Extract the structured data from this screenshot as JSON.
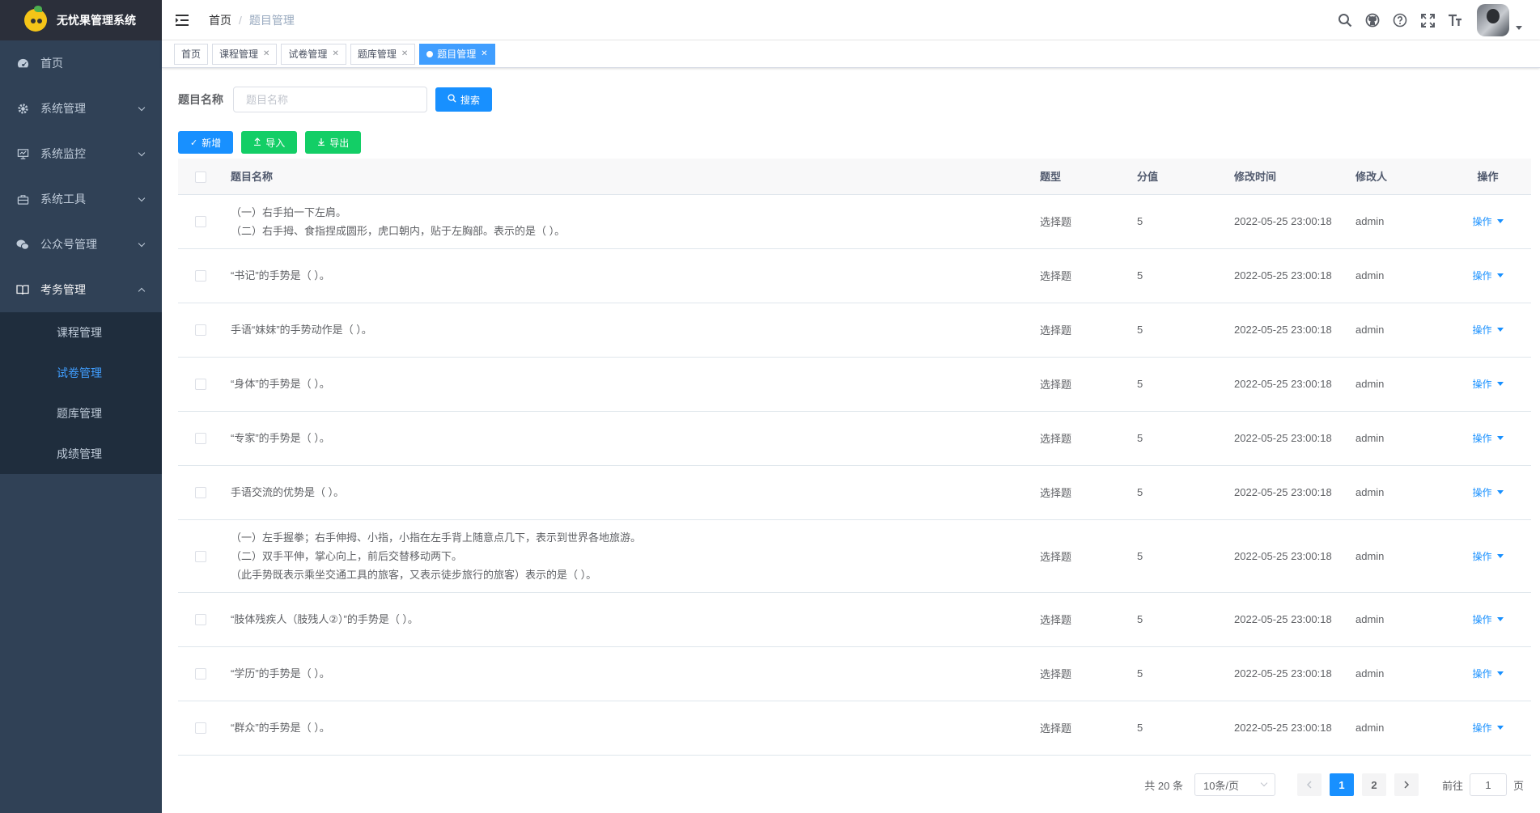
{
  "app": {
    "title": "无忧果管理系统"
  },
  "sidebar": {
    "items": [
      {
        "label": "首页",
        "icon": "dashboard-icon"
      },
      {
        "label": "系统管理",
        "icon": "gear-icon"
      },
      {
        "label": "系统监控",
        "icon": "monitor-icon"
      },
      {
        "label": "系统工具",
        "icon": "toolbox-icon"
      },
      {
        "label": "公众号管理",
        "icon": "wechat-icon"
      },
      {
        "label": "考务管理",
        "icon": "book-icon"
      }
    ],
    "submenu": [
      {
        "label": "课程管理"
      },
      {
        "label": "试卷管理"
      },
      {
        "label": "题库管理"
      },
      {
        "label": "成绩管理"
      }
    ]
  },
  "breadcrumb": {
    "home": "首页",
    "separator": "/",
    "current": "题目管理"
  },
  "tags": [
    {
      "label": "首页"
    },
    {
      "label": "课程管理"
    },
    {
      "label": "试卷管理"
    },
    {
      "label": "题库管理"
    },
    {
      "label": "题目管理"
    }
  ],
  "search": {
    "label": "题目名称",
    "placeholder": "题目名称",
    "button": "搜索"
  },
  "toolbar": {
    "add": "新增",
    "import": "导入",
    "export": "导出"
  },
  "table": {
    "headers": {
      "name": "题目名称",
      "type": "题型",
      "score": "分值",
      "time": "修改时间",
      "user": "修改人",
      "op": "操作"
    },
    "rows": [
      {
        "name": "（一）右手拍一下左肩。\n（二）右手拇、食指捏成圆形，虎口朝内，贴于左胸部。表示的是（   ）。",
        "type": "选择题",
        "score": "5",
        "time": "2022-05-25 23:00:18",
        "user": "admin",
        "op": "操作"
      },
      {
        "name": "“书记”的手势是（    ）。",
        "type": "选择题",
        "score": "5",
        "time": "2022-05-25 23:00:18",
        "user": "admin",
        "op": "操作"
      },
      {
        "name": "手语“妹妹”的手势动作是（    ）。",
        "type": "选择题",
        "score": "5",
        "time": "2022-05-25 23:00:18",
        "user": "admin",
        "op": "操作"
      },
      {
        "name": "“身体”的手势是（    ）。",
        "type": "选择题",
        "score": "5",
        "time": "2022-05-25 23:00:18",
        "user": "admin",
        "op": "操作"
      },
      {
        "name": "“专家”的手势是（    ）。",
        "type": "选择题",
        "score": "5",
        "time": "2022-05-25 23:00:18",
        "user": "admin",
        "op": "操作"
      },
      {
        "name": "手语交流的优势是（        ）。",
        "type": "选择题",
        "score": "5",
        "time": "2022-05-25 23:00:18",
        "user": "admin",
        "op": "操作"
      },
      {
        "name": "（一）左手握拳；右手伸拇、小指，小指在左手背上随意点几下，表示到世界各地旅游。\n（二）双手平伸，掌心向上，前后交替移动两下。\n（此手势既表示乘坐交通工具的旅客，又表示徒步旅行的旅客）表示的是（   ）。",
        "type": "选择题",
        "score": "5",
        "time": "2022-05-25 23:00:18",
        "user": "admin",
        "op": "操作"
      },
      {
        "name": "“肢体残疾人（肢残人②）”的手势是（    ）。",
        "type": "选择题",
        "score": "5",
        "time": "2022-05-25 23:00:18",
        "user": "admin",
        "op": "操作"
      },
      {
        "name": "“学历”的手势是（    ）。",
        "type": "选择题",
        "score": "5",
        "time": "2022-05-25 23:00:18",
        "user": "admin",
        "op": "操作"
      },
      {
        "name": "“群众”的手势是（    ）。",
        "type": "选择题",
        "score": "5",
        "time": "2022-05-25 23:00:18",
        "user": "admin",
        "op": "操作"
      }
    ]
  },
  "pagination": {
    "total": "共 20 条",
    "size": "10条/页",
    "pages": [
      "1",
      "2"
    ],
    "jump_prefix": "前往",
    "jump_value": "1",
    "jump_suffix": "页"
  }
}
